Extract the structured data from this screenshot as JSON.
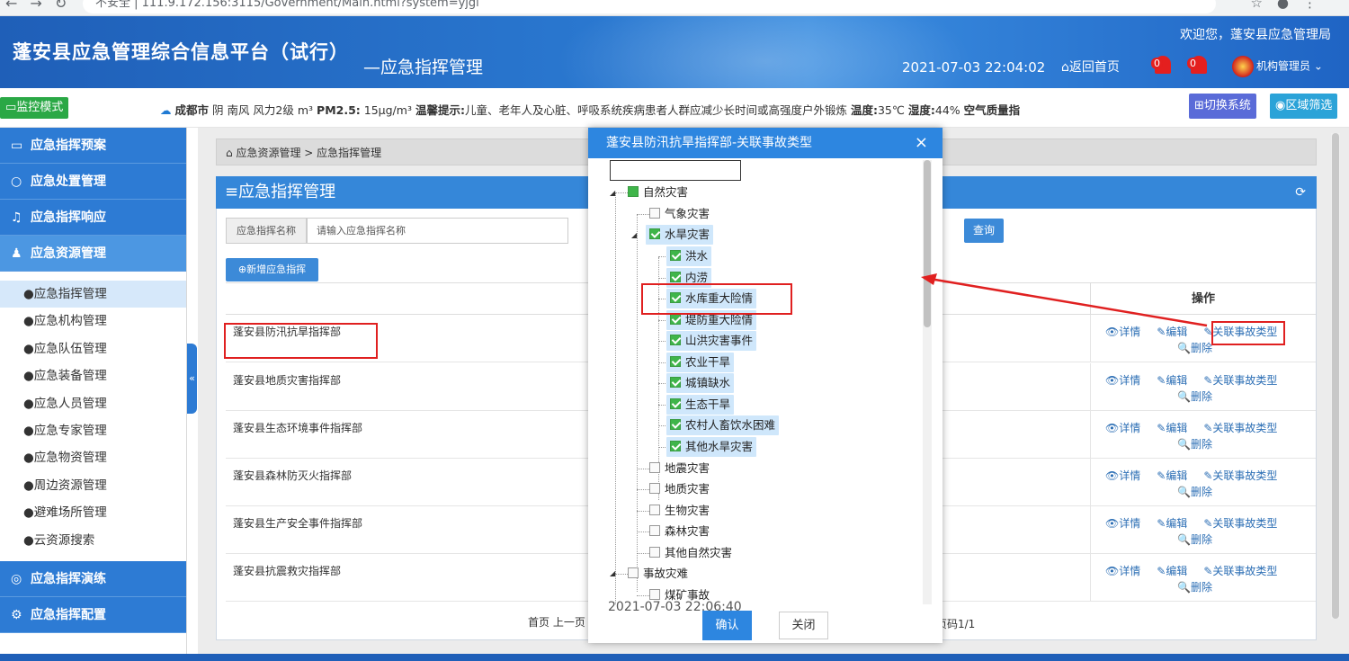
{
  "browser": {
    "url_text": "不安全 | 111.9.172.156:3115/Government/Main.html?system=yjgl"
  },
  "header": {
    "system_title": "蓬安县应急管理综合信息平台（试行）",
    "subtitle": "—应急指挥管理",
    "welcome": "欢迎您，蓬安县应急管理局",
    "datetime": "2021-07-03 22:04:02",
    "home_label": "返回首页",
    "badge1": "0",
    "badge2": "0",
    "org_label": "机构管理员"
  },
  "infobar": {
    "monitor_label": "监控模式",
    "city": "成都市",
    "weather_text": "阴 南风 风力2级  m³",
    "pm_label": "PM2.5:",
    "pm_value": "15μg/m³",
    "tip_label": "温馨提示:",
    "tip_text": "儿童、老年人及心脏、呼吸系统疾病患者人群应减少长时间或高强度户外锻炼",
    "temp_label": "温度:",
    "temp_value": "35℃",
    "humidity_label": "湿度:",
    "humidity_value": "44%",
    "air_label": "空气质量指",
    "switch_label": "切换系统",
    "region_label": "区域筛选"
  },
  "sidebar": {
    "top_items": [
      {
        "label": "应急指挥预案"
      },
      {
        "label": "应急处置管理"
      },
      {
        "label": "应急指挥响应"
      },
      {
        "label": "应急资源管理"
      }
    ],
    "sub_items": [
      {
        "label": "●应急指挥管理"
      },
      {
        "label": "●应急机构管理"
      },
      {
        "label": "●应急队伍管理"
      },
      {
        "label": "●应急装备管理"
      },
      {
        "label": "●应急人员管理"
      },
      {
        "label": "●应急专家管理"
      },
      {
        "label": "●应急物资管理"
      },
      {
        "label": "●周边资源管理"
      },
      {
        "label": "●避难场所管理"
      },
      {
        "label": "●云资源搜索"
      }
    ],
    "bottom_items": [
      {
        "label": "应急指挥演练"
      },
      {
        "label": "应急指挥配置"
      }
    ]
  },
  "main": {
    "breadcrumb": "应急资源管理 > 应急指挥管理",
    "panel_title": "≡应急指挥管理",
    "search_label": "应急指挥名称",
    "search_placeholder": "请输入应急指挥名称",
    "query_label": "查询",
    "add_label": "新增应急指挥",
    "op_header": "操作",
    "rows": [
      {
        "name": "蓬安县防汛抗旱指挥部"
      },
      {
        "name": "蓬安县地质灾害指挥部"
      },
      {
        "name": "蓬安县生态环境事件指挥部"
      },
      {
        "name": "蓬安县森林防灭火指挥部"
      },
      {
        "name": "蓬安县生产安全事件指挥部"
      },
      {
        "name": "蓬安县抗震救灾指挥部"
      }
    ],
    "op_detail": "详情",
    "op_edit": "编辑",
    "op_link": "关联事故类型",
    "op_delete": "删除",
    "pager_left": "首页 上一页",
    "pager_right": "页码1/1"
  },
  "dialog": {
    "title": "蓬安县防汛抗旱指挥部-关联事故类型",
    "nodes": [
      "自然灾害",
      "气象灾害",
      "水旱灾害",
      "洪水",
      "内涝",
      "水库重大险情",
      "堤防重大险情",
      "山洪灾害事件",
      "农业干旱",
      "城镇缺水",
      "生态干旱",
      "农村人畜饮水困难",
      "其他水旱灾害",
      "地震灾害",
      "地质灾害",
      "生物灾害",
      "森林灾害",
      "其他自然灾害",
      "事故灾难",
      "煤矿事故"
    ],
    "timestamp": "2021-07-03 22:06:40",
    "ok_label": "确认",
    "close_label": "关闭"
  }
}
